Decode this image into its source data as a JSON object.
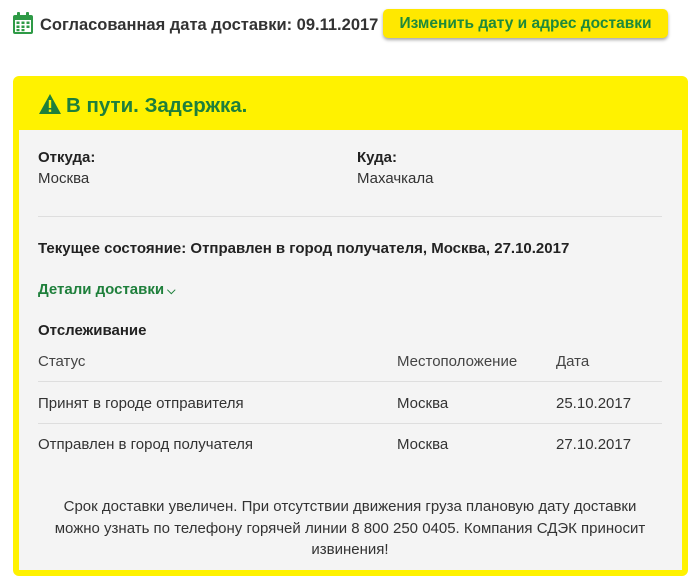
{
  "header": {
    "agreed_date_label": "Согласованная дата доставки: 09.11.2017",
    "change_button": "Изменить дату и адрес доставки"
  },
  "card": {
    "status_title": "В пути. Задержка.",
    "from_label": "Откуда:",
    "from_value": "Москва",
    "to_label": "Куда:",
    "to_value": "Махачкала",
    "current_state": "Текущее состояние: Отправлен в город получателя, Москва, 27.10.2017",
    "details_link": "Детали доставки",
    "tracking_title": "Отслеживание",
    "table": {
      "headers": [
        "Статус",
        "Местоположение",
        "Дата"
      ],
      "rows": [
        [
          "Принят в городе отправителя",
          "Москва",
          "25.10.2017"
        ],
        [
          "Отправлен в город получателя",
          "Москва",
          "27.10.2017"
        ]
      ]
    },
    "note_lines": [
      "Срок доставки увеличен. При отсутствии движения груза плановую дату доставки",
      "можно узнать по телефону горячей линии 8 800 250 0405. Компания СДЭК приносит",
      "извинения!"
    ]
  },
  "colors": {
    "accent_yellow": "#fff200",
    "button_yellow": "#ffe800",
    "green": "#1e7f3b",
    "panel_bg": "#f4f4f4"
  },
  "icons": {
    "calendar": "calendar-icon",
    "warning": "warning-icon",
    "chevron": "chevron-down-icon"
  }
}
